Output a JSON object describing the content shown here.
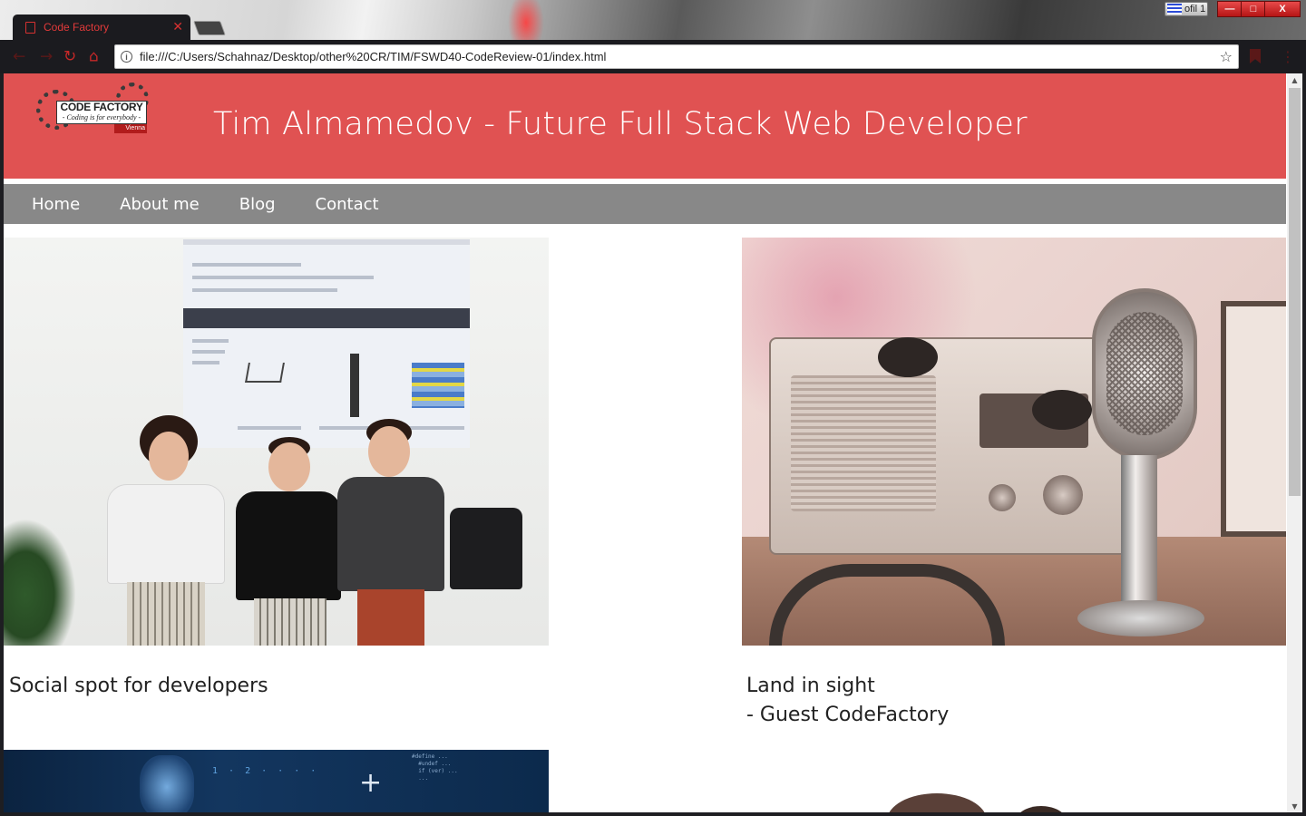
{
  "browser": {
    "tab_title": "Code Factory",
    "url": "file:///C:/Users/Schahnaz/Desktop/other%20CR/TIM/FSWD40-CodeReview-01/index.html",
    "profile_label": "ofil 1",
    "window_buttons": {
      "minimize": "—",
      "maximize": "□",
      "close": "X"
    }
  },
  "site": {
    "logo": {
      "brand": "CODE FACTORY",
      "tagline": "- Coding is for everybody -",
      "city": "Vienna"
    },
    "title": "Tim Almamedov - Future Full Stack Web Developer",
    "nav": [
      "Home",
      "About me",
      "Blog",
      "Contact"
    ],
    "cards": [
      {
        "caption_lines": [
          "Social spot for developers"
        ]
      },
      {
        "caption_lines": [
          "Land in sight",
          "- Guest CodeFactory"
        ]
      }
    ]
  },
  "colors": {
    "header_red": "#e05252",
    "nav_gray": "#888888",
    "chrome_dark": "#1b1b1f",
    "accent_red": "#d63131"
  },
  "icons": {
    "back": "back-arrow-icon",
    "forward": "forward-arrow-icon",
    "reload": "reload-icon",
    "home": "home-icon",
    "info": "info-icon",
    "bookmark": "star-icon",
    "menu": "kebab-menu-icon"
  }
}
